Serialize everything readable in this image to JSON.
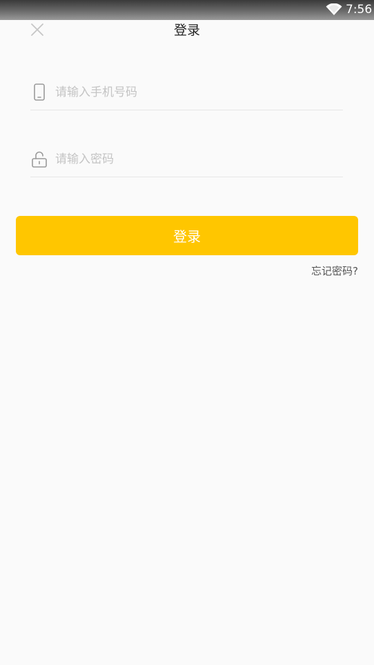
{
  "status_bar": {
    "time": "7:56",
    "icons": [
      "wifi-icon"
    ]
  },
  "header": {
    "title": "登录",
    "close_icon": "close-icon"
  },
  "form": {
    "phone": {
      "icon": "mobile-phone-icon",
      "placeholder": "请输入手机号码",
      "value": ""
    },
    "password": {
      "icon": "lock-icon",
      "placeholder": "请输入密码",
      "value": ""
    }
  },
  "login_button": {
    "label": "登录"
  },
  "forgot_password": {
    "label": "忘记密码?"
  },
  "colors": {
    "accent": "#ffc600",
    "background": "#fafafa",
    "placeholder": "#c4c4c4",
    "divider": "#e6e6e6"
  }
}
